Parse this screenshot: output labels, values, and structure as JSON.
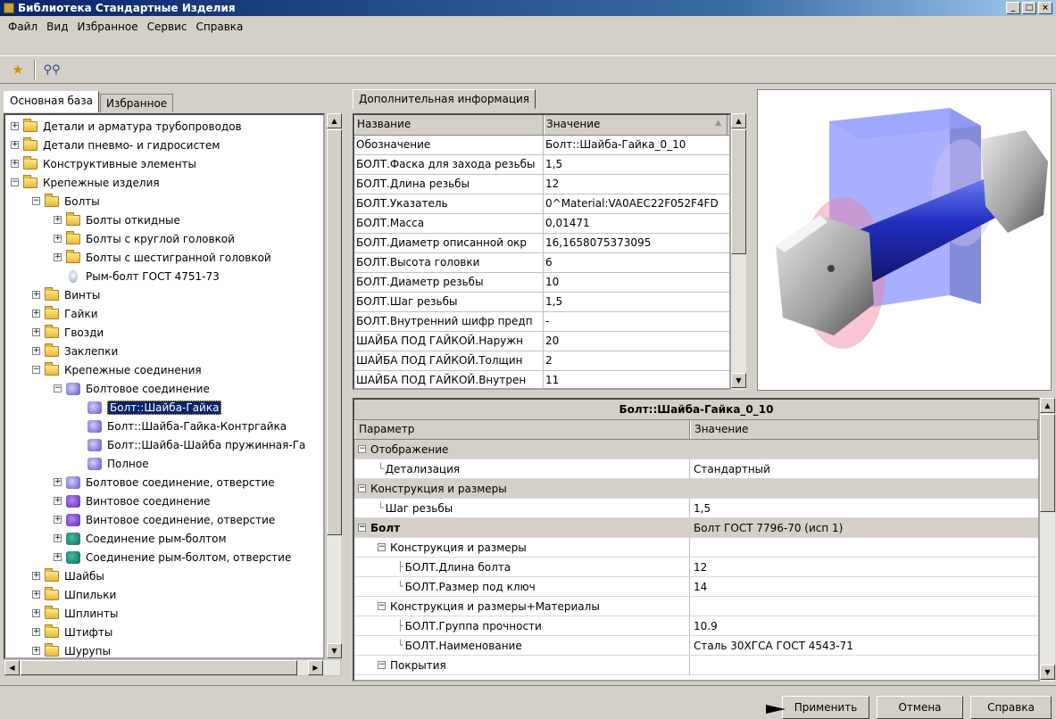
{
  "window": {
    "title": "Библиотека Стандартные Изделия"
  },
  "menu": [
    "Файл",
    "Вид",
    "Избранное",
    "Сервис",
    "Справка"
  ],
  "tabs_left": [
    "Основная база",
    "Избранное"
  ],
  "tree": [
    {
      "label": "Детали и арматура трубопроводов"
    },
    {
      "label": "Детали пневмо- и гидросистем"
    },
    {
      "label": "Конструктивные элементы"
    },
    {
      "label": "Крепежные изделия"
    },
    {
      "label": "Болты"
    },
    {
      "label": "Болты откидные"
    },
    {
      "label": "Болты с круглой головкой"
    },
    {
      "label": "Болты с шестигранной головкой"
    },
    {
      "label": "Рым-болт ГОСТ 4751-73"
    },
    {
      "label": "Винты"
    },
    {
      "label": "Гайки"
    },
    {
      "label": "Гвозди"
    },
    {
      "label": "Заклепки"
    },
    {
      "label": "Крепежные соединения"
    },
    {
      "label": "Болтовое соединение"
    },
    {
      "label": "Болт::Шайба-Гайка"
    },
    {
      "label": "Болт::Шайба-Гайка-Контргайка"
    },
    {
      "label": "Болт::Шайба-Шайба пружинная-Га"
    },
    {
      "label": "Полное"
    },
    {
      "label": "Болтовое соединение, отверстие"
    },
    {
      "label": "Винтовое соединение"
    },
    {
      "label": "Винтовое соединение, отверстие"
    },
    {
      "label": "Соединение рым-болтом"
    },
    {
      "label": "Соединение рым-болтом, отверстие"
    },
    {
      "label": "Шайбы"
    },
    {
      "label": "Шпильки"
    },
    {
      "label": "Шплинты"
    },
    {
      "label": "Штифты"
    },
    {
      "label": "Шурупы"
    }
  ],
  "info": {
    "tab": "Дополнительная информация",
    "col_name": "Название",
    "col_value": "Значение",
    "rows": [
      {
        "name": "Обозначение",
        "value": "Болт::Шайба-Гайка_0_10"
      },
      {
        "name": "БОЛТ.Фаска для захода резьбы",
        "value": "1,5"
      },
      {
        "name": "БОЛТ.Длина резьбы",
        "value": "12"
      },
      {
        "name": "БОЛТ.Указатель",
        "value": "0^Material:VA0AEC22F052F4FD"
      },
      {
        "name": "БОЛТ.Масса",
        "value": "0,01471"
      },
      {
        "name": "БОЛТ.Диаметр описанной окр",
        "value": "16,1658075373095"
      },
      {
        "name": "БОЛТ.Высота головки",
        "value": "6"
      },
      {
        "name": "БОЛТ.Диаметр резьбы",
        "value": "10"
      },
      {
        "name": "БОЛТ.Шаг резьбы",
        "value": "1,5"
      },
      {
        "name": "БОЛТ.Внутренний шифр предп",
        "value": "-"
      },
      {
        "name": "ШАЙБА ПОД ГАЙКОЙ.Наружн",
        "value": "20"
      },
      {
        "name": "ШАЙБА ПОД ГАЙКОЙ.Толщин",
        "value": "2"
      },
      {
        "name": "ШАЙБА ПОД ГАЙКОЙ.Внутрен",
        "value": "11"
      }
    ]
  },
  "props": {
    "title": "Болт::Шайба-Гайка_0_10",
    "col_param": "Параметр",
    "col_value": "Значение",
    "rows": [
      {
        "param": "Отображение",
        "value": ""
      },
      {
        "param": "Детализация",
        "value": "Стандартный"
      },
      {
        "param": "Конструкция и размеры",
        "value": ""
      },
      {
        "param": "Шаг резьбы",
        "value": "1,5"
      },
      {
        "param": "Болт",
        "value": "Болт ГОСТ 7796-70 (исп 1)"
      },
      {
        "param": "Конструкция и размеры",
        "value": ""
      },
      {
        "param": "БОЛТ.Длина болта",
        "value": "12"
      },
      {
        "param": "БОЛТ.Размер под ключ",
        "value": "14"
      },
      {
        "param": "Конструкция и размеры+Материалы",
        "value": ""
      },
      {
        "param": "БОЛТ.Группа прочности",
        "value": "10.9"
      },
      {
        "param": "БОЛТ.Наименование",
        "value": "Сталь 30ХГСА ГОСТ 4543-71"
      },
      {
        "param": "Покрытия",
        "value": ""
      }
    ]
  },
  "buttons": {
    "apply": "Применить",
    "cancel": "Отмена",
    "help": "Справка"
  },
  "colors": {
    "selection": "#0a246a",
    "face": "#d4d0c8"
  }
}
